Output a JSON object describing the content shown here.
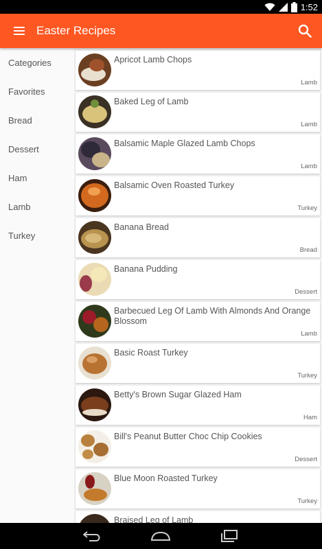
{
  "status_bar": {
    "time": "1:52",
    "icons": [
      "wifi-icon",
      "cellular-signal-icon",
      "battery-icon"
    ]
  },
  "app_bar": {
    "title": "Easter Recipes",
    "menu_icon": "hamburger-menu-icon",
    "search_icon": "search-icon",
    "color": "#ff5722"
  },
  "sidebar": {
    "items": [
      {
        "label": "Categories"
      },
      {
        "label": "Favorites"
      },
      {
        "label": "Bread"
      },
      {
        "label": "Dessert"
      },
      {
        "label": "Ham"
      },
      {
        "label": "Lamb"
      },
      {
        "label": "Turkey"
      }
    ]
  },
  "recipes": [
    {
      "title": "Apricot Lamb Chops",
      "category": "Lamb"
    },
    {
      "title": "Baked Leg of Lamb",
      "category": "Lamb"
    },
    {
      "title": "Balsamic Maple Glazed Lamb Chops",
      "category": "Lamb"
    },
    {
      "title": "Balsamic Oven Roasted Turkey",
      "category": "Turkey"
    },
    {
      "title": "Banana Bread",
      "category": "Bread"
    },
    {
      "title": "Banana Pudding",
      "category": "Dessert"
    },
    {
      "title": "Barbecued Leg Of Lamb With Almonds And Orange Blossom",
      "category": "Lamb"
    },
    {
      "title": "Basic Roast Turkey",
      "category": "Turkey"
    },
    {
      "title": "Betty's Brown Sugar Glazed Ham",
      "category": "Ham"
    },
    {
      "title": "Bill's Peanut Butter Choc Chip Cookies",
      "category": "Dessert"
    },
    {
      "title": "Blue Moon Roasted Turkey",
      "category": "Turkey"
    },
    {
      "title": "Braised Leg of Lamb",
      "category": ""
    }
  ],
  "nav_bar": {
    "icons": [
      "back-icon",
      "home-icon",
      "recent-apps-icon"
    ]
  }
}
